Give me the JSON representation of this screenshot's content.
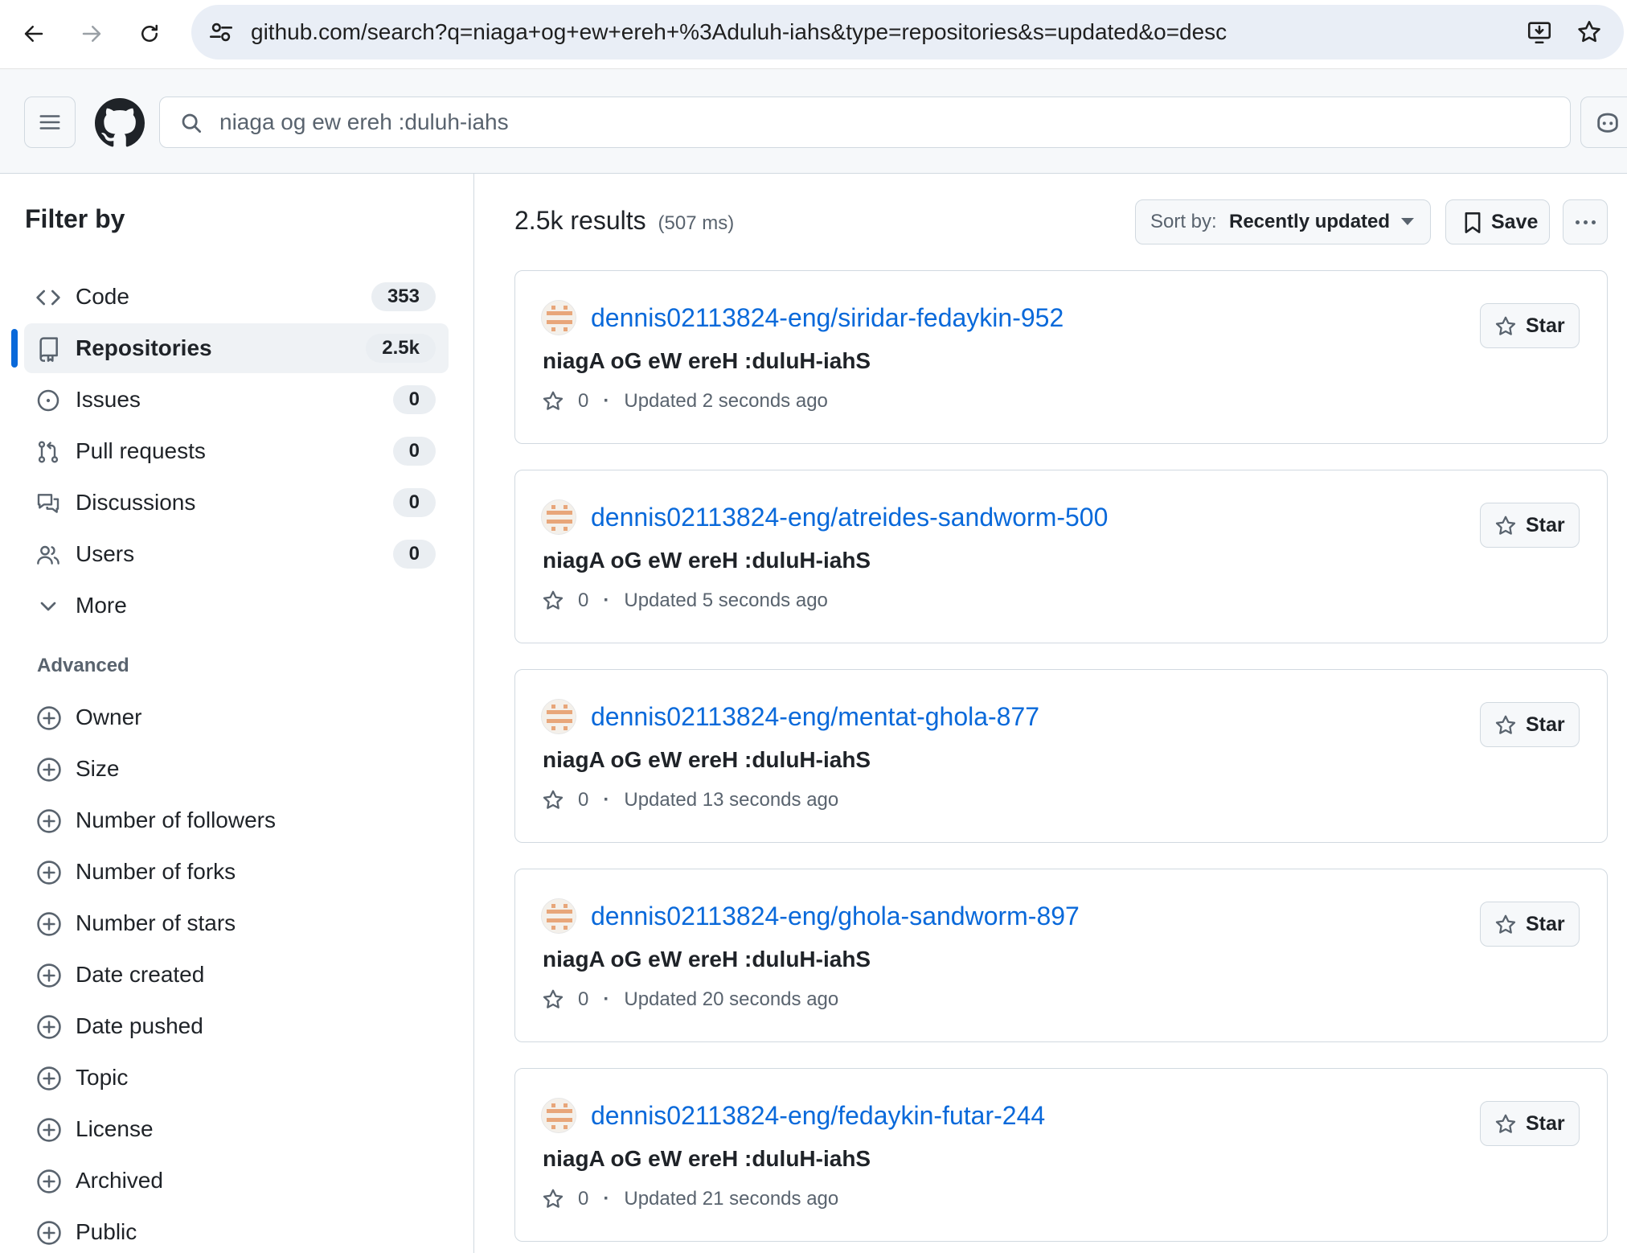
{
  "browser": {
    "url": "github.com/search?q=niaga+og+ew+ereh+%3Aduluh-iahs&type=repositories&s=updated&o=desc"
  },
  "header": {
    "search_value": "niaga og ew ereh :duluh-iahs"
  },
  "sidebar": {
    "title": "Filter by",
    "items": [
      {
        "label": "Code",
        "count": "353",
        "icon": "code-icon"
      },
      {
        "label": "Repositories",
        "count": "2.5k",
        "icon": "repo-icon",
        "active": true
      },
      {
        "label": "Issues",
        "count": "0",
        "icon": "issue-icon"
      },
      {
        "label": "Pull requests",
        "count": "0",
        "icon": "pull-request-icon"
      },
      {
        "label": "Discussions",
        "count": "0",
        "icon": "discussion-icon"
      },
      {
        "label": "Users",
        "count": "0",
        "icon": "people-icon"
      },
      {
        "label": "More",
        "icon": "chevron-down-icon"
      }
    ],
    "advanced_title": "Advanced",
    "advanced": [
      {
        "label": "Owner"
      },
      {
        "label": "Size"
      },
      {
        "label": "Number of followers"
      },
      {
        "label": "Number of forks"
      },
      {
        "label": "Number of stars"
      },
      {
        "label": "Date created"
      },
      {
        "label": "Date pushed"
      },
      {
        "label": "Topic"
      },
      {
        "label": "License"
      },
      {
        "label": "Archived"
      },
      {
        "label": "Public"
      }
    ]
  },
  "main": {
    "results_count": "2.5k results",
    "results_time": "(507 ms)",
    "sort_prefix": "Sort by:",
    "sort_value": "Recently updated",
    "save_label": "Save",
    "results": [
      {
        "repo": "dennis02113824-eng/siridar-fedaykin-952",
        "description": "niagA oG eW ereH :duluH-iahS",
        "stars": "0",
        "updated": "Updated 2 seconds ago",
        "star_label": "Star"
      },
      {
        "repo": "dennis02113824-eng/atreides-sandworm-500",
        "description": "niagA oG eW ereH :duluH-iahS",
        "stars": "0",
        "updated": "Updated 5 seconds ago",
        "star_label": "Star"
      },
      {
        "repo": "dennis02113824-eng/mentat-ghola-877",
        "description": "niagA oG eW ereH :duluH-iahS",
        "stars": "0",
        "updated": "Updated 13 seconds ago",
        "star_label": "Star"
      },
      {
        "repo": "dennis02113824-eng/ghola-sandworm-897",
        "description": "niagA oG eW ereH :duluH-iahS",
        "stars": "0",
        "updated": "Updated 20 seconds ago",
        "star_label": "Star"
      },
      {
        "repo": "dennis02113824-eng/fedaykin-futar-244",
        "description": "niagA oG eW ereH :duluH-iahS",
        "stars": "0",
        "updated": "Updated 21 seconds ago",
        "star_label": "Star"
      }
    ]
  },
  "colors": {
    "link": "#0969da",
    "text": "#1f2328",
    "muted": "#59636e",
    "border": "#d1d9e0",
    "avatar_accent": "#e8a67a"
  }
}
